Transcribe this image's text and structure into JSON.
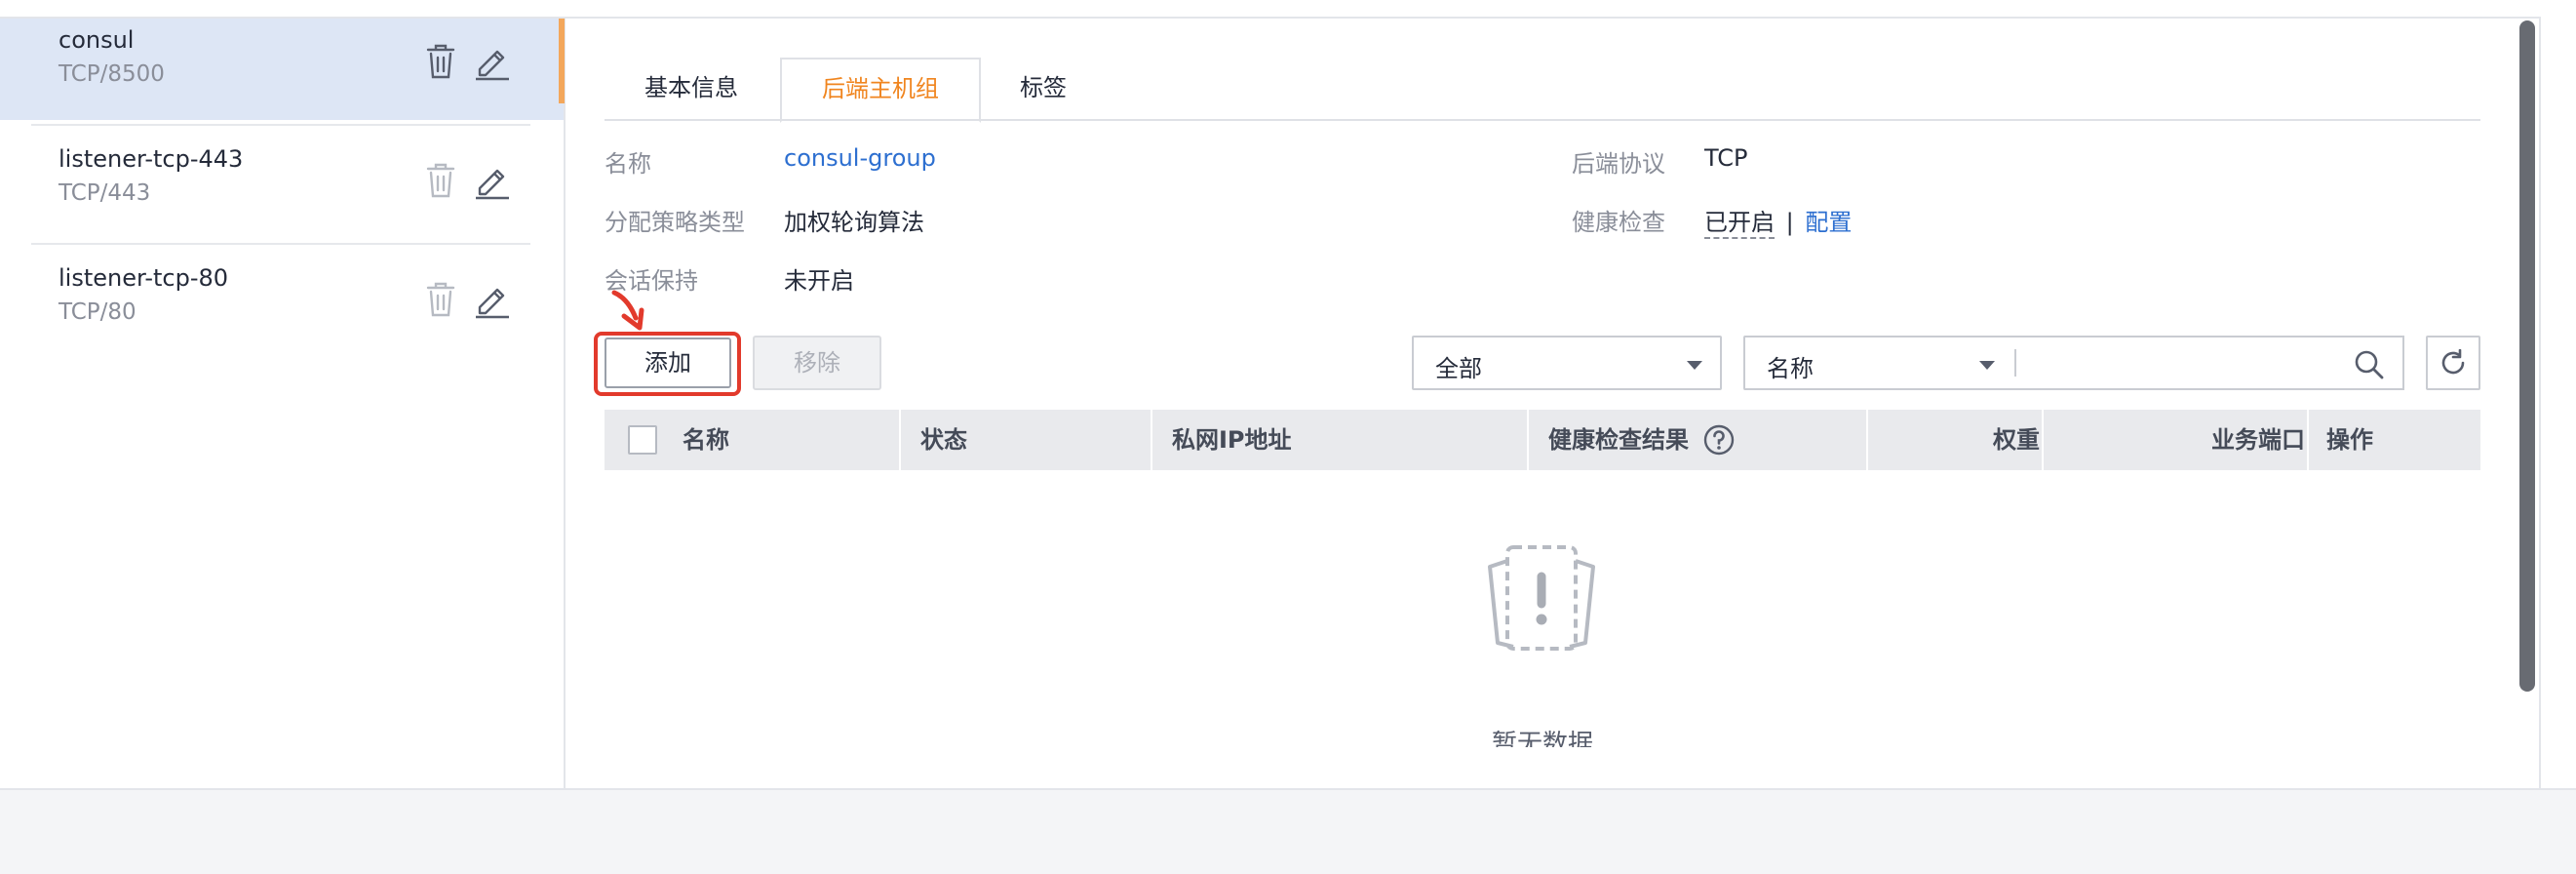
{
  "listeners": [
    {
      "name": "consul",
      "protocol": "TCP/8500",
      "selected": true
    },
    {
      "name": "listener-tcp-443",
      "protocol": "TCP/443",
      "selected": false
    },
    {
      "name": "listener-tcp-80",
      "protocol": "TCP/80",
      "selected": false
    }
  ],
  "tabs": [
    {
      "label": "基本信息",
      "active": false
    },
    {
      "label": "后端主机组",
      "active": true
    },
    {
      "label": "标签",
      "active": false
    }
  ],
  "info": {
    "name_label": "名称",
    "name_value": "consul-group",
    "strategy_label": "分配策略类型",
    "strategy_value": "加权轮询算法",
    "session_label": "会话保持",
    "session_value": "未开启",
    "protocol_label": "后端协议",
    "protocol_value": "TCP",
    "health_label": "健康检查",
    "health_value": "已开启",
    "health_sep": "|",
    "health_config": "配置"
  },
  "toolbar": {
    "add_label": "添加",
    "remove_label": "移除",
    "status_filter": "全部",
    "search_field": "名称",
    "search_placeholder": ""
  },
  "table": {
    "columns": [
      "名称",
      "状态",
      "私网IP地址",
      "健康检查结果",
      "权重",
      "业务端口",
      "操作"
    ],
    "rows": [],
    "empty_text": "暂无数据"
  },
  "colors": {
    "accent_orange": "#f0851f",
    "link_blue": "#2d6fd0",
    "highlight_red": "#e23a2c",
    "selected_bg": "#dde6f5"
  },
  "icons": [
    "trash-icon",
    "edit-icon",
    "search-icon",
    "refresh-icon",
    "help-circle-icon",
    "empty-data-icon",
    "annotation-arrow-icon"
  ]
}
